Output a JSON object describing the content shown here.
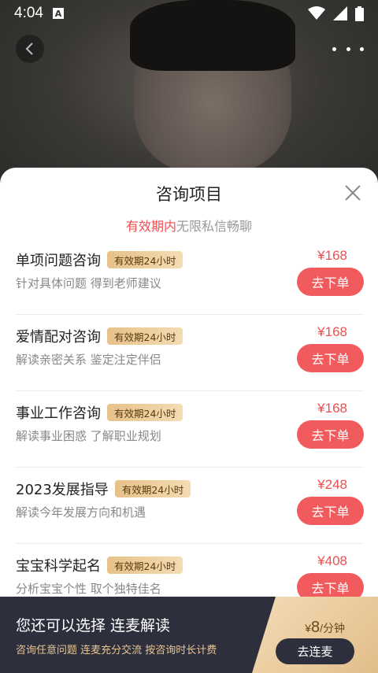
{
  "status_bar": {
    "time": "4:04",
    "notification_icon": "a-icon",
    "wifi_icon": "wifi-icon",
    "signal_icon": "signal-icon",
    "battery_icon": "battery-icon"
  },
  "header": {
    "back_icon": "chevron-left-icon",
    "more_icon": "more-dots-icon"
  },
  "sheet": {
    "title": "咨询项目",
    "close_icon": "close-icon",
    "subtitle_highlight": "有效期内",
    "subtitle_rest": "无限私信畅聊"
  },
  "items": [
    {
      "name": "单项问题咨询",
      "badge": "有效期24小时",
      "desc": "针对具体问题 得到老师建议",
      "price": "¥168",
      "button": "去下单"
    },
    {
      "name": "爱情配对咨询",
      "badge": "有效期24小时",
      "desc": "解读亲密关系 鉴定注定伴侣",
      "price": "¥168",
      "button": "去下单"
    },
    {
      "name": "事业工作咨询",
      "badge": "有效期24小时",
      "desc": "解读事业困惑 了解职业规划",
      "price": "¥168",
      "button": "去下单"
    },
    {
      "name": "2023发展指导",
      "badge": "有效期24小时",
      "desc": "解读今年发展方向和机遇",
      "price": "¥248",
      "button": "去下单"
    },
    {
      "name": "宝宝科学起名",
      "badge": "有效期24小时",
      "desc": "分析宝宝个性 取个独特佳名",
      "price": "¥408",
      "button": "去下单"
    }
  ],
  "bottom": {
    "title": "您还可以选择 连麦解读",
    "desc": "咨询任意问题 连麦充分交流 按咨询时长计费",
    "price_symbol": "¥",
    "price_value": "8",
    "price_unit": "/分钟",
    "button": "去连麦"
  },
  "colors": {
    "accent": "#f25b5d",
    "price": "#ef4d4f",
    "badge_gold": "#e7c189",
    "bottom_bg": "#2e2f3d"
  }
}
